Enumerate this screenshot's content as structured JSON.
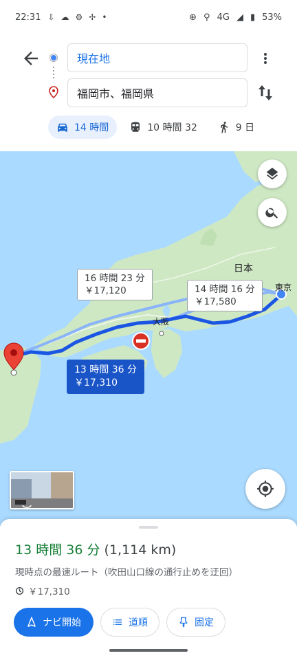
{
  "status_bar": {
    "time": "22:31",
    "network": "4G",
    "battery": "53%"
  },
  "search": {
    "origin": "現在地",
    "destination": "福岡市、福岡県"
  },
  "modes": [
    {
      "label": "14 時間",
      "icon": "car-icon",
      "active": true
    },
    {
      "label": "10 時間 32",
      "icon": "train-icon",
      "active": false
    },
    {
      "label": "9 日",
      "icon": "walk-icon",
      "active": false
    }
  ],
  "map": {
    "labels": {
      "japan": "日本",
      "osaka": "大阪",
      "tokyo": "東京"
    },
    "routes": [
      {
        "time": "16 時間 23 分",
        "cost": "￥17,120",
        "selected": false
      },
      {
        "time": "14 時間 16 分",
        "cost": "￥17,580",
        "selected": false
      },
      {
        "time": "13 時間 36 分",
        "cost": "￥17,310",
        "selected": true
      }
    ],
    "colors": {
      "water": "#aadaff",
      "land": "#cfe8c4",
      "route_main": "#1a55e3",
      "route_alt": "#8ab4f8"
    }
  },
  "sheet": {
    "duration": "13 時間 36 分",
    "distance": "(1,114 km)",
    "description": "現時点の最速ルート（吹田山口線の通行止めを迂回）",
    "toll": "￥17,310",
    "buttons": {
      "start": "ナビ開始",
      "steps": "道順",
      "pin": "固定"
    }
  }
}
